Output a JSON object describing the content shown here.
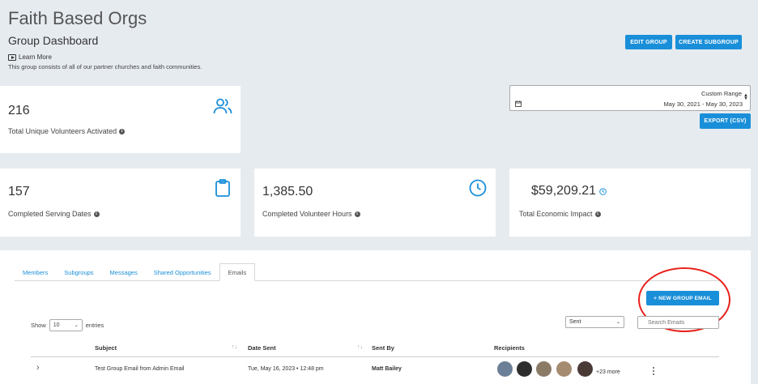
{
  "header": {
    "title": "Faith Based Orgs",
    "subtitle": "Group Dashboard",
    "learn_more": "Learn More",
    "description": "This group consists of all of our partner churches and faith communities.",
    "edit_group": "EDIT GROUP",
    "create_subgroup": "CREATE SUBGROUP"
  },
  "date_range": {
    "label": "Custom Range",
    "value": "May 30, 2021 - May 30, 2023",
    "export": "EXPORT (CSV)"
  },
  "stats": {
    "volunteers": {
      "value": "216",
      "label": "Total Unique Volunteers Activated",
      "icon": "users-icon"
    },
    "serving_dates": {
      "value": "157",
      "label": "Completed Serving Dates",
      "icon": "clipboard-icon"
    },
    "hours": {
      "value": "1,385.50",
      "label": "Completed Volunteer Hours",
      "icon": "clock-icon"
    },
    "impact": {
      "value": "$59,209.21",
      "label": "Total Economic Impact",
      "icon": "clock-small-icon"
    }
  },
  "tabs": [
    {
      "label": "Members"
    },
    {
      "label": "Subgroups"
    },
    {
      "label": "Messages"
    },
    {
      "label": "Shared Opportunities"
    },
    {
      "label": "Emails"
    }
  ],
  "active_tab": "Emails",
  "emails": {
    "new_button": "+ NEW GROUP EMAIL",
    "show_label": "Show",
    "entries_value": "10",
    "entries_label": "entries",
    "filter_value": "Sent",
    "search_placeholder": "Search Emails",
    "columns": {
      "subject": "Subject",
      "date_sent": "Date Sent",
      "sent_by": "Sent By",
      "recipients": "Recipients"
    },
    "rows": [
      {
        "subject": "Test Group Email from Admin Email",
        "date_sent": "Tue, May 16, 2023 • 12:48 pm",
        "sent_by": "Matt Bailey",
        "more_recipients": "+23 more"
      }
    ]
  },
  "colors": {
    "accent": "#1a8fd9",
    "highlight_circle": "#e8201b",
    "background": "#e6ebf0"
  }
}
